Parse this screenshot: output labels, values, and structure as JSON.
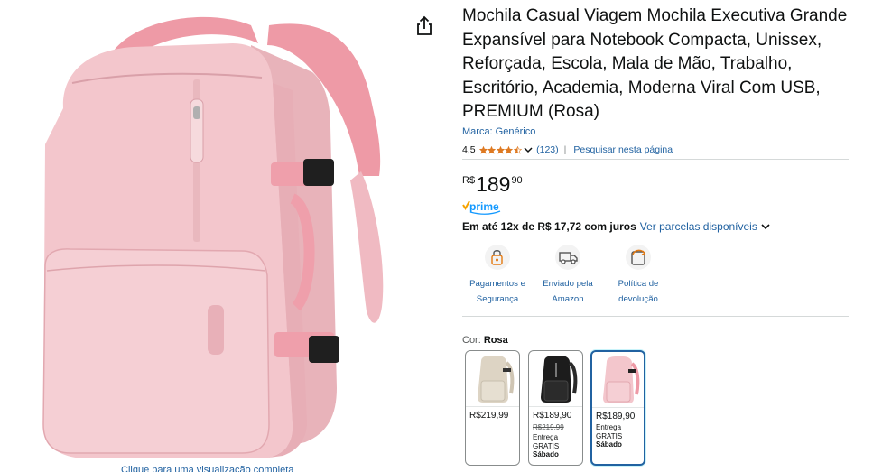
{
  "product": {
    "title": "Mochila Casual Viagem Mochila Executiva Grande Expansível para Notebook Compacta, Unissex, Reforçada, Escola, Mala de Mão, Trabalho, Escritório, Academia, Moderna Viral Com USB, PREMIUM (Rosa)",
    "brand": "Marca: Genérico",
    "rating": "4,5",
    "stars_value": 4.5,
    "review_count": "(123)",
    "search_page": "Pesquisar nesta página",
    "zoom_hint": "Clique para uma visualização completa"
  },
  "price": {
    "currency": "R$",
    "whole": "189",
    "fraction": "90",
    "installments_bold": "Em até 12x de R$ 17,72 com juros",
    "installments_link": "Ver parcelas disponíveis"
  },
  "prime": {
    "label": "prime",
    "color": "#1399ff"
  },
  "badges": [
    {
      "icon": "secure-payment-icon",
      "line1": "Pagamentos e",
      "line2": "Segurança"
    },
    {
      "icon": "delivery-truck-icon",
      "line1": "Enviado pela",
      "line2": "Amazon"
    },
    {
      "icon": "return-policy-icon",
      "line1": "Política de",
      "line2": "devolução"
    }
  ],
  "color_selector": {
    "label": "Cor:",
    "selected": "Rosa",
    "options": [
      {
        "color": "beige",
        "price": "R$219,99",
        "old_price": "",
        "ship1": "",
        "ship2": "",
        "ship3": ""
      },
      {
        "color": "black",
        "price": "R$189,90",
        "old_price": "R$219,99",
        "ship1": "Entrega",
        "ship2": "GRATIS",
        "ship3": "Sábado"
      },
      {
        "color": "pink",
        "price": "R$189,90",
        "old_price": "",
        "ship1": "Entrega",
        "ship2": "GRATIS",
        "ship3": "Sábado",
        "selected": true
      }
    ]
  },
  "colors": {
    "link": "#2162a1",
    "star": "#de7921",
    "text": "#0f1111",
    "backpack_pink": "#f2c5cb",
    "strap_pink": "#ee9aa6"
  }
}
